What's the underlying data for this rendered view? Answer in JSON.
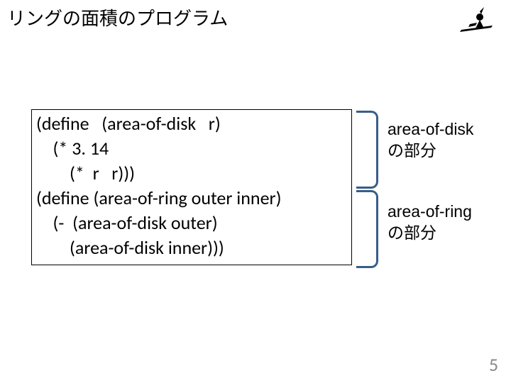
{
  "title": "リングの面積のプログラム",
  "code": "(define   (area-of-disk   r)\n    (* 3. 14 \n        (*  r   r)))\n(define (area-of-ring outer inner)\n    (-  (area-of-disk outer)\n        (area-of-disk inner)))",
  "annotations": {
    "disk": {
      "name": "area-of-disk",
      "suffix": "の部分"
    },
    "ring": {
      "name": "area-of-ring",
      "suffix": "の部分"
    }
  },
  "page_number": "5",
  "logo_label": "witch"
}
